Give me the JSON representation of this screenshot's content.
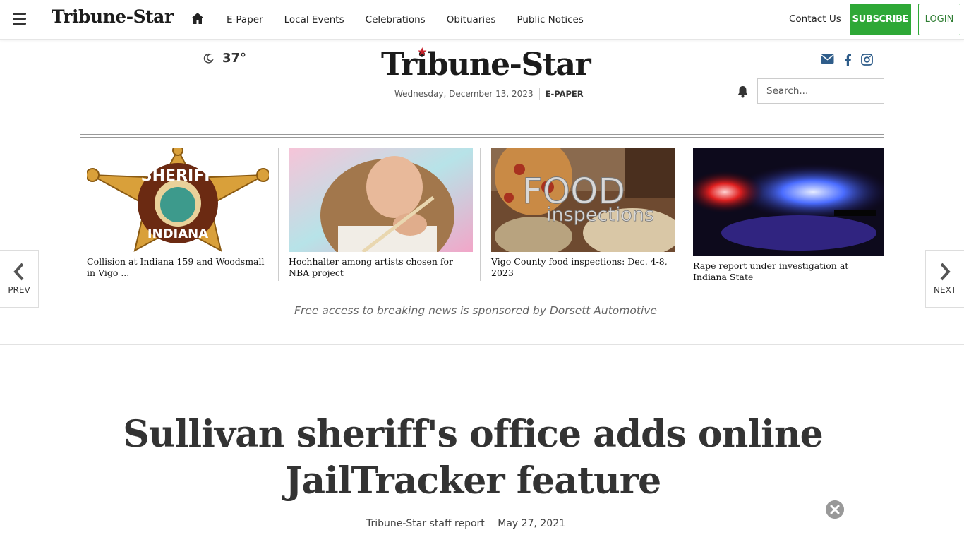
{
  "nav": {
    "logo": "Tribune-Star",
    "links": [
      "E-Paper",
      "Local Events",
      "Celebrations",
      "Obituaries",
      "Public Notices"
    ],
    "contact": "Contact Us",
    "subscribe": "SUBSCRIBE",
    "login": "LOGIN"
  },
  "masthead": {
    "temperature": "37°",
    "logo": "Tribune-Star",
    "date": "Wednesday, December 13, 2023",
    "epaper": "E-PAPER",
    "search_placeholder": "Search..."
  },
  "carousel": {
    "prev": "PREV",
    "next": "NEXT",
    "items": [
      {
        "title": "Collision at Indiana 159 and Woodsmall in Vigo ..."
      },
      {
        "title": "Hochhalter among artists chosen for NBA project"
      },
      {
        "title": "Vigo County food inspections: Dec. 4-8, 2023"
      },
      {
        "title": "Rape report under investigation at Indiana State"
      }
    ],
    "badge_sheriff_top": "SHERIFF",
    "badge_sheriff_bottom": "INDIANA",
    "food_word1": "FOOD",
    "food_word2": "inspections"
  },
  "sponsor": "Free access to breaking news is sponsored by Dorsett Automotive",
  "article": {
    "headline": "Sullivan sheriff's office adds online JailTracker feature",
    "author": "Tribune-Star staff report",
    "date": "May 27, 2021"
  },
  "colors": {
    "brand_green": "#2ea836",
    "logo_star": "#c8202a",
    "social_blue": "#2f5d8a"
  }
}
